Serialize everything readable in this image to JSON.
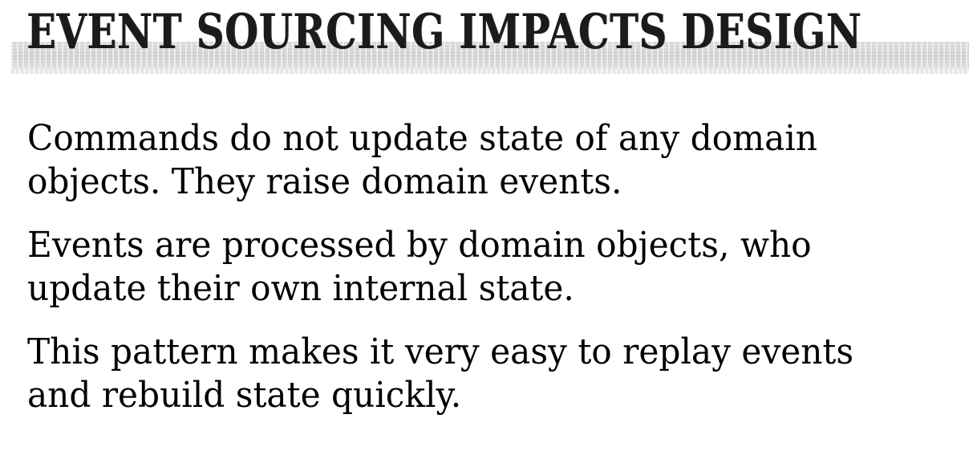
{
  "slide": {
    "title": "EVENT SOURCING IMPACTS DESIGN",
    "bullets": [
      {
        "line1": "Commands do not update state of any domain",
        "line2": "objects. They raise domain events."
      },
      {
        "line1": "Events are processed by domain objects, who",
        "line2": "update their own internal state."
      },
      {
        "line1": "This pattern makes it very easy to replay events",
        "line2": "and rebuild state quickly."
      }
    ]
  },
  "colors": {
    "title": "#1b1b1b",
    "text": "#000000",
    "band": "#cccccc",
    "background": "#ffffff"
  }
}
